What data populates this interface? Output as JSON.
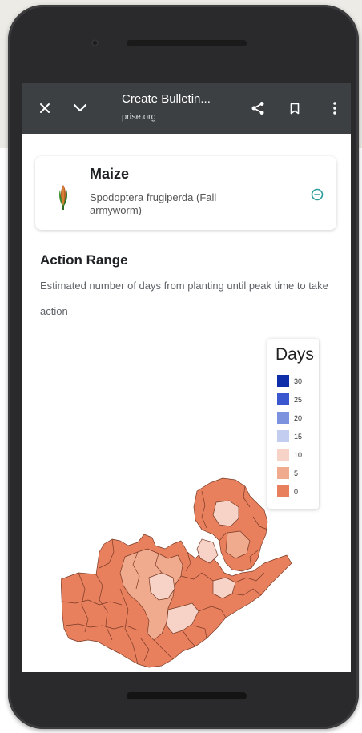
{
  "toolbar": {
    "title": "Create Bulletin...",
    "url": "prise.org"
  },
  "crop_card": {
    "crop": "Maize",
    "pest": "Spodoptera frugiperda (Fall armyworm)"
  },
  "section": {
    "title": "Action Range",
    "description": "Estimated number of days from planting until peak time to take action"
  },
  "legend": {
    "title": "Days",
    "items": [
      {
        "label": "30",
        "color": "#0d2ea8"
      },
      {
        "label": "25",
        "color": "#3b57cf"
      },
      {
        "label": "20",
        "color": "#7d92de"
      },
      {
        "label": "15",
        "color": "#c3cdf0"
      },
      {
        "label": "10",
        "color": "#f6d3c6"
      },
      {
        "label": "5",
        "color": "#f0ab8e"
      },
      {
        "label": "0",
        "color": "#e8805e"
      }
    ]
  }
}
